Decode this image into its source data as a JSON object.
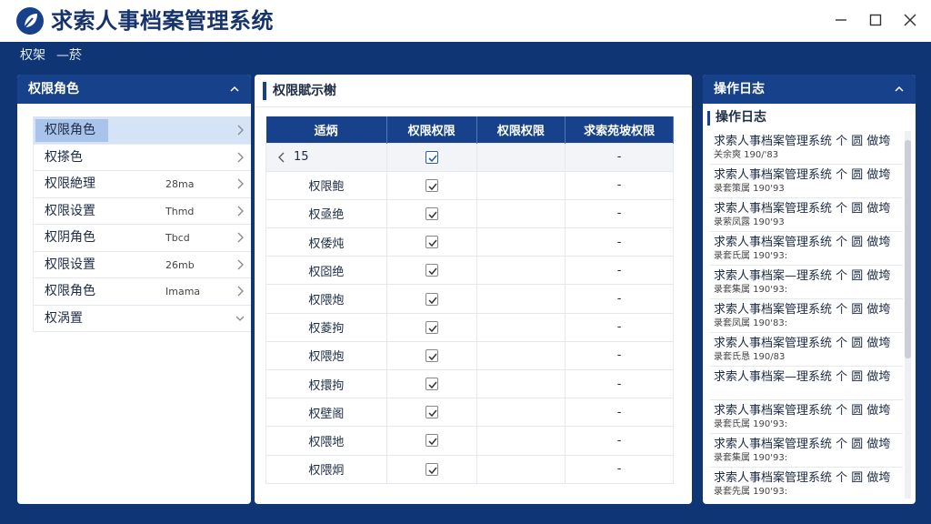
{
  "window": {
    "title": "求索人事档案管理系统",
    "logo_icon": "leaf-logo-icon",
    "controls": [
      "minimize-icon",
      "maximize-icon",
      "close-icon"
    ]
  },
  "breadcrumb": {
    "items": [
      "权架",
      "—菸"
    ]
  },
  "left_panel": {
    "title": "权限角色",
    "items": [
      {
        "label": "权限角色",
        "meta": "",
        "active": true
      },
      {
        "label": "权搽色",
        "meta": ""
      },
      {
        "label": "权限絶理",
        "meta": "28ma"
      },
      {
        "label": "权限设置",
        "meta": "Thmd"
      },
      {
        "label": "权阴角色",
        "meta": "Tbcd"
      },
      {
        "label": "权限设置",
        "meta": "26mb"
      },
      {
        "label": "权限角色",
        "meta": "Imama"
      },
      {
        "label": "权涡置",
        "meta": ""
      }
    ]
  },
  "mid_panel": {
    "title": "权限賦示榭",
    "columns": [
      "适炳",
      "权限权限",
      "权限权限",
      "求索苑坡权限"
    ],
    "first_row": {
      "label": "15",
      "checked": true,
      "dash": "-"
    },
    "rows": [
      {
        "label": "权限鲍",
        "checked": true,
        "dash": "-"
      },
      {
        "label": "权亟绝",
        "checked": true,
        "dash": "-"
      },
      {
        "label": "权倭炖",
        "checked": true,
        "dash": "-"
      },
      {
        "label": "权囵绝",
        "checked": true,
        "dash": "-"
      },
      {
        "label": "权隈炮",
        "checked": true,
        "dash": "-"
      },
      {
        "label": "权菱拘",
        "checked": true,
        "dash": "-"
      },
      {
        "label": "权隈炮",
        "checked": true,
        "dash": "-"
      },
      {
        "label": "权擐拘",
        "checked": true,
        "dash": "-"
      },
      {
        "label": "权壁阁",
        "checked": true,
        "dash": "-"
      },
      {
        "label": "权隈地",
        "checked": true,
        "dash": "-"
      },
      {
        "label": "权隈炯",
        "checked": true,
        "dash": "-"
      }
    ]
  },
  "right_panel": {
    "title": "操作日志",
    "subtitle": "操作日志",
    "logs": [
      {
        "line1": "求索人事档案管理系统 个 圆 做垮",
        "line2": "关余爽 190/'83"
      },
      {
        "line1": "求索人事档案管理系统 个 圆 做垮",
        "line2": "录套策属 190'93"
      },
      {
        "line1": "求索人事档案管理系统 个 圆 做垮",
        "line2": "录萦凤露 190'93"
      },
      {
        "line1": "求索人事档案管理系统 个 圆 做垮",
        "line2": "录套氏属 190'93:"
      },
      {
        "line1": "求索人事档案—理系统 个 圆 做垮",
        "line2": "录套集属 190'93:"
      },
      {
        "line1": "求索人事档案管理系统 个 圆 做垮",
        "line2": "录套凤属 190'83:"
      },
      {
        "line1": "求索人事档案管理系统 个 圆 做垮",
        "line2": "录套氏恳 190/83"
      },
      {
        "line1": "求索人事档案—理系统 个 圆 做垮",
        "line2": ""
      },
      {
        "line1": "求索人事档案管理系统 个 圆 做垮",
        "line2": "录套氏属 190'93:"
      },
      {
        "line1": "求索人事档案管理系统 个 圆 做垮",
        "line2": "录套集属 190'93:"
      },
      {
        "line1": "求索人事档案管理系统 个 圆 做垮",
        "line2": "录套先属 190'93:"
      }
    ]
  },
  "colors": {
    "primary": "#17418a",
    "background": "#0f3575",
    "active_row": "#d5e3f6"
  }
}
